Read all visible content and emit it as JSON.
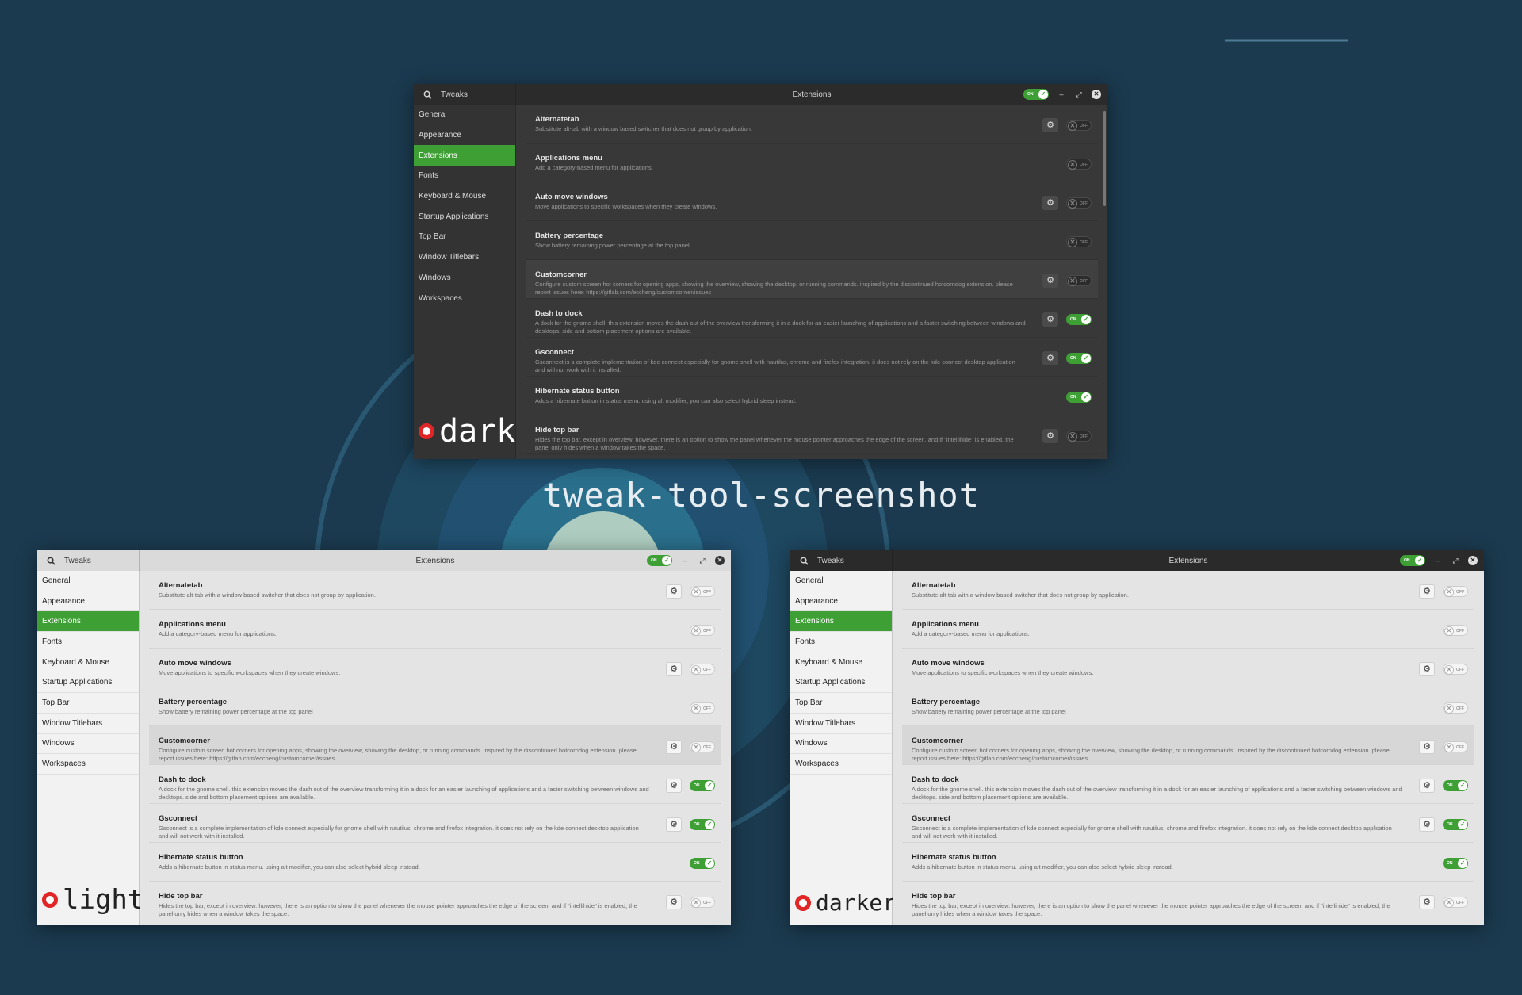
{
  "heading": "tweak-tool-screenshot",
  "colors": {
    "background": "#1b3a4f",
    "accent": "#3e9f35",
    "brand_dot": "#e02626"
  },
  "window": {
    "app_title": "Tweaks",
    "title": "Extensions",
    "search_icon": "search-icon",
    "header_toggle": "ON",
    "minimize_glyph": "–",
    "maximize_glyph": "⤢",
    "close_glyph": "✕"
  },
  "sidebar": {
    "items": [
      {
        "label": "General"
      },
      {
        "label": "Appearance"
      },
      {
        "label": "Extensions",
        "active": true
      },
      {
        "label": "Fonts"
      },
      {
        "label": "Keyboard & Mouse"
      },
      {
        "label": "Startup Applications"
      },
      {
        "label": "Top Bar"
      },
      {
        "label": "Window Titlebars"
      },
      {
        "label": "Windows"
      },
      {
        "label": "Workspaces"
      }
    ]
  },
  "extensions": [
    {
      "name": "Alternatetab",
      "desc": "Substitute alt-tab with a window based switcher that does not group by application.",
      "has_settings": true,
      "enabled": false,
      "highlight": false
    },
    {
      "name": "Applications menu",
      "desc": "Add a category-based menu for applications.",
      "has_settings": false,
      "enabled": false,
      "highlight": false
    },
    {
      "name": "Auto move windows",
      "desc": "Move applications to specific workspaces when they create windows.",
      "has_settings": true,
      "enabled": false,
      "highlight": false
    },
    {
      "name": "Battery percentage",
      "desc": "Show battery remaining power percentage at the top panel",
      "has_settings": false,
      "enabled": false,
      "highlight": false
    },
    {
      "name": "Customcorner",
      "desc": "Configure custom screen hot corners for opening apps, showing the overview, showing the desktop, or running commands. inspired by the discontinued hotcorndog extension. please report issues here: https://gitlab.com/eccheng/customcorner/issues",
      "has_settings": true,
      "enabled": false,
      "highlight": true
    },
    {
      "name": "Dash to dock",
      "desc": "A dock for the gnome shell. this extension moves the dash out of the overview transforming it in a dock for an easier launching of applications and a faster switching between windows and desktops. side and bottom placement options are available.",
      "has_settings": true,
      "enabled": true,
      "highlight": false
    },
    {
      "name": "Gsconnect",
      "desc": "Gsconnect is a complete implementation of kde connect especially for gnome shell with nautilus, chrome and firefox integration. it does not rely on the kde connect desktop application and will not work with it installed.",
      "has_settings": true,
      "enabled": true,
      "highlight": false
    },
    {
      "name": "Hibernate status button",
      "desc": "Adds a hibernate button in status menu. using alt modifier, you can also select hybrid sleep instead.",
      "has_settings": false,
      "enabled": true,
      "highlight": false
    },
    {
      "name": "Hide top bar",
      "desc": "Hides the top bar, except in overview. however, there is an option to show the panel whenever the mouse pointer approaches the edge of the screen. and if \"intellihide\" is enabled, the panel only hides when a window takes the space.",
      "has_settings": true,
      "enabled": false,
      "highlight": false
    }
  ],
  "toggle_labels": {
    "on": "ON",
    "off": "OFF"
  },
  "icons": {
    "gear": "gear-icon",
    "check": "check-icon",
    "x": "x-icon"
  },
  "variants": [
    {
      "theme": "dark",
      "label": "dark"
    },
    {
      "theme": "light",
      "label": "light"
    },
    {
      "theme": "darker",
      "label": "darker"
    }
  ]
}
